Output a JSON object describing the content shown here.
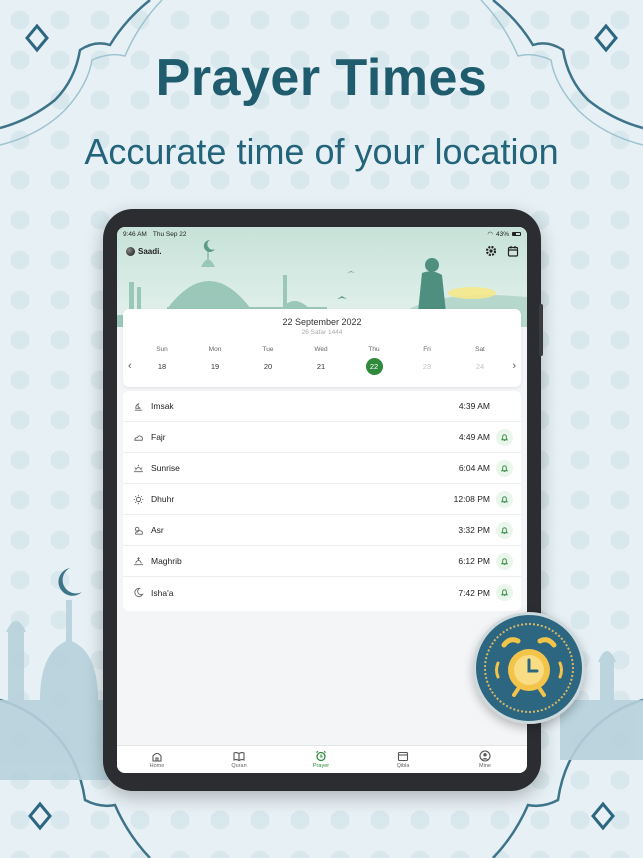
{
  "headline": "Prayer Times",
  "subheadline": "Accurate time of your location",
  "colors": {
    "brand_teal": "#1f5c6e",
    "accent_green": "#2f8a3c",
    "badge_blue": "#2d6680",
    "alarm_yellow": "#f3c44a"
  },
  "status_bar": {
    "time": "9:46 AM",
    "date": "Thu Sep 22",
    "battery": "43%"
  },
  "app": {
    "brand_name": "Saadi.",
    "icons": [
      "settings-icon",
      "calendar-icon"
    ]
  },
  "calendar": {
    "gregorian_date": "22 September 2022",
    "hijri_date": "26 Safar 1444",
    "days": [
      {
        "name": "Sun",
        "date": "18",
        "state": "past"
      },
      {
        "name": "Mon",
        "date": "19",
        "state": "past"
      },
      {
        "name": "Tue",
        "date": "20",
        "state": "past"
      },
      {
        "name": "Wed",
        "date": "21",
        "state": "past"
      },
      {
        "name": "Thu",
        "date": "22",
        "state": "selected"
      },
      {
        "name": "Fri",
        "date": "23",
        "state": "future"
      },
      {
        "name": "Sat",
        "date": "24",
        "state": "future"
      }
    ]
  },
  "prayers": [
    {
      "name": "Imsak",
      "time": "4:39 AM",
      "icon": "imsak-icon",
      "bell": false
    },
    {
      "name": "Fajr",
      "time": "4:49 AM",
      "icon": "fajr-icon",
      "bell": true
    },
    {
      "name": "Sunrise",
      "time": "6:04 AM",
      "icon": "sunrise-icon",
      "bell": true
    },
    {
      "name": "Dhuhr",
      "time": "12:08 PM",
      "icon": "sun-icon",
      "bell": true
    },
    {
      "name": "Asr",
      "time": "3:32 PM",
      "icon": "cloud-sun-icon",
      "bell": true
    },
    {
      "name": "Maghrib",
      "time": "6:12 PM",
      "icon": "sunset-icon",
      "bell": true
    },
    {
      "name": "Isha'a",
      "time": "7:42 PM",
      "icon": "moon-icon",
      "bell": true
    }
  ],
  "tabs": [
    {
      "label": "Home",
      "icon": "mosque-icon",
      "active": false
    },
    {
      "label": "Quran",
      "icon": "book-icon",
      "active": false
    },
    {
      "label": "Prayer",
      "icon": "alarm-clock-icon",
      "active": true
    },
    {
      "label": "Qibla",
      "icon": "kaaba-icon",
      "active": false
    },
    {
      "label": "Mine",
      "icon": "profile-icon",
      "active": false
    }
  ]
}
